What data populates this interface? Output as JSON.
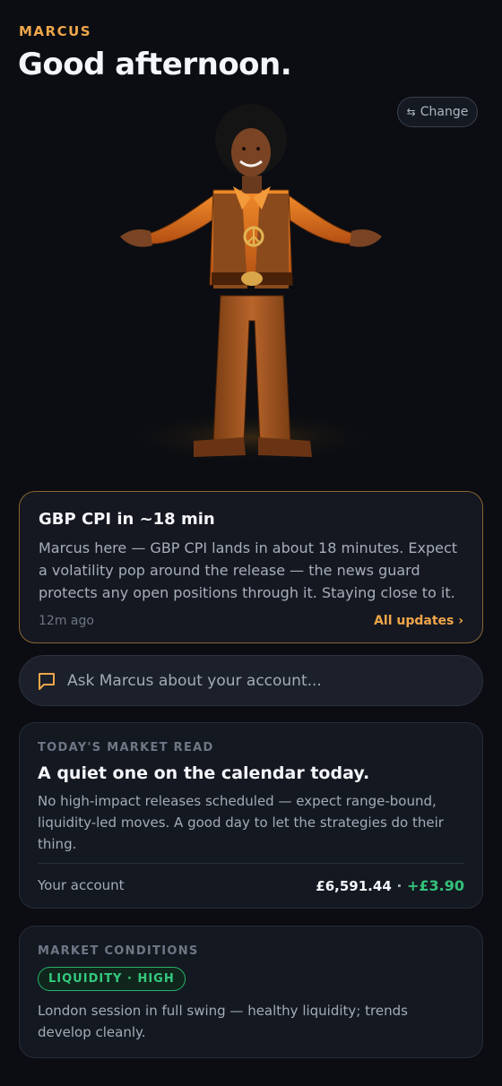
{
  "header": {
    "eyebrow": "MARCUS",
    "greeting": "Good afternoon.",
    "change_label": "Change"
  },
  "update": {
    "title": "GBP CPI in ~18 min",
    "body": "Marcus here — GBP CPI lands in about 18 minutes. Expect a volatility pop around the release — the news guard protects any open positions through it. Staying close to it.",
    "time_ago": "12m ago",
    "all_updates": "All updates ›"
  },
  "ask": {
    "placeholder": "Ask Marcus about your account..."
  },
  "market_read": {
    "label": "TODAY'S MARKET READ",
    "title": "A quiet one on the calendar today.",
    "body": "No high-impact releases scheduled — expect range-bound, liquidity-led moves. A good day to let the strategies do their thing.",
    "account_label": "Your account",
    "account_value": "£6,591.44",
    "separator": " · ",
    "account_change": "+£3.90"
  },
  "conditions": {
    "label": "MARKET CONDITIONS",
    "badge": "LIQUIDITY · HIGH",
    "body": "London session in full swing — healthy liquidity; trends develop cleanly."
  },
  "colors": {
    "accent": "#f0a64a",
    "positive": "#33c27a",
    "background": "#0b0d12"
  }
}
